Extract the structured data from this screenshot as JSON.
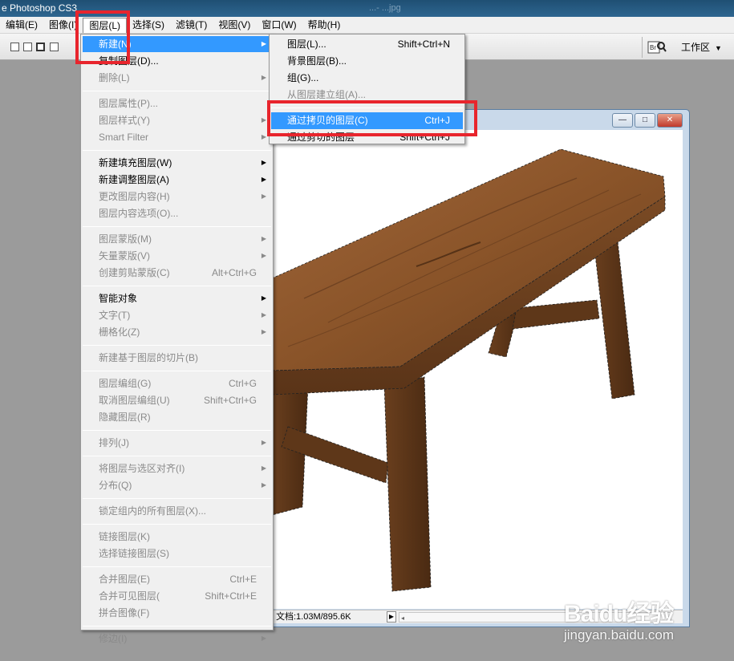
{
  "app": {
    "title": "e Photoshop CS3",
    "ghost_text": "...- ...jpg"
  },
  "menubar": [
    {
      "label": "编辑(E)"
    },
    {
      "label": "图像(I)"
    },
    {
      "label": "图层(L)"
    },
    {
      "label": "选择(S)"
    },
    {
      "label": "滤镜(T)"
    },
    {
      "label": "视图(V)"
    },
    {
      "label": "窗口(W)"
    },
    {
      "label": "帮助(H)"
    }
  ],
  "options_bar": {
    "workspace_label": "工作区",
    "bridge_icon": "bridge-icon"
  },
  "layer_menu": [
    {
      "label": "新建(N)",
      "submenu": true,
      "highlighted": true
    },
    {
      "label": "复制图层(D)..."
    },
    {
      "label": "删除(L)",
      "submenu": true,
      "disabled": true
    },
    {
      "sep": true
    },
    {
      "label": "图层属性(P)...",
      "disabled": true
    },
    {
      "label": "图层样式(Y)",
      "submenu": true,
      "disabled": true
    },
    {
      "label": "Smart Filter",
      "submenu": true,
      "disabled": true
    },
    {
      "sep": true
    },
    {
      "label": "新建填充图层(W)",
      "submenu": true
    },
    {
      "label": "新建调整图层(A)",
      "submenu": true
    },
    {
      "label": "更改图层内容(H)",
      "submenu": true,
      "disabled": true
    },
    {
      "label": "图层内容选项(O)...",
      "disabled": true
    },
    {
      "sep": true
    },
    {
      "label": "图层蒙版(M)",
      "submenu": true,
      "disabled": true
    },
    {
      "label": "矢量蒙版(V)",
      "submenu": true,
      "disabled": true
    },
    {
      "label": "创建剪贴蒙版(C)",
      "shortcut": "Alt+Ctrl+G",
      "disabled": true
    },
    {
      "sep": true
    },
    {
      "label": "智能对象",
      "submenu": true
    },
    {
      "label": "文字(T)",
      "submenu": true,
      "disabled": true
    },
    {
      "label": "栅格化(Z)",
      "submenu": true,
      "disabled": true
    },
    {
      "sep": true
    },
    {
      "label": "新建基于图层的切片(B)",
      "disabled": true
    },
    {
      "sep": true
    },
    {
      "label": "图层编组(G)",
      "shortcut": "Ctrl+G",
      "disabled": true
    },
    {
      "label": "取消图层编组(U)",
      "shortcut": "Shift+Ctrl+G",
      "disabled": true
    },
    {
      "label": "隐藏图层(R)",
      "disabled": true
    },
    {
      "sep": true
    },
    {
      "label": "排列(J)",
      "submenu": true,
      "disabled": true
    },
    {
      "sep": true
    },
    {
      "label": "将图层与选区对齐(I)",
      "submenu": true,
      "disabled": true
    },
    {
      "label": "分布(Q)",
      "submenu": true,
      "disabled": true
    },
    {
      "sep": true
    },
    {
      "label": "锁定组内的所有图层(X)...",
      "disabled": true
    },
    {
      "sep": true
    },
    {
      "label": "链接图层(K)",
      "disabled": true
    },
    {
      "label": "选择链接图层(S)",
      "disabled": true
    },
    {
      "sep": true
    },
    {
      "label": "合并图层(E)",
      "shortcut": "Ctrl+E",
      "disabled": true
    },
    {
      "label": "合并可见图层(",
      "shortcut": "Shift+Ctrl+E",
      "disabled": true
    },
    {
      "label": "拼合图像(F)",
      "disabled": true
    },
    {
      "sep": true
    },
    {
      "label": "修边(I)",
      "submenu": true,
      "disabled": true
    }
  ],
  "new_submenu": [
    {
      "label": "图层(L)...",
      "shortcut": "Shift+Ctrl+N"
    },
    {
      "label": "背景图层(B)..."
    },
    {
      "label": "组(G)..."
    },
    {
      "label": "从图层建立组(A)...",
      "disabled": true
    },
    {
      "sep": true
    },
    {
      "label": "通过拷贝的图层(C)",
      "shortcut": "Ctrl+J",
      "highlighted": true
    },
    {
      "label": "通过剪切的图层",
      "shortcut": "Shift+Ctrl+J"
    }
  ],
  "document": {
    "status": "文档:1.03M/895.6K"
  },
  "watermark": {
    "logo": "Baidu经验",
    "site": "jingyan.baidu.com"
  }
}
